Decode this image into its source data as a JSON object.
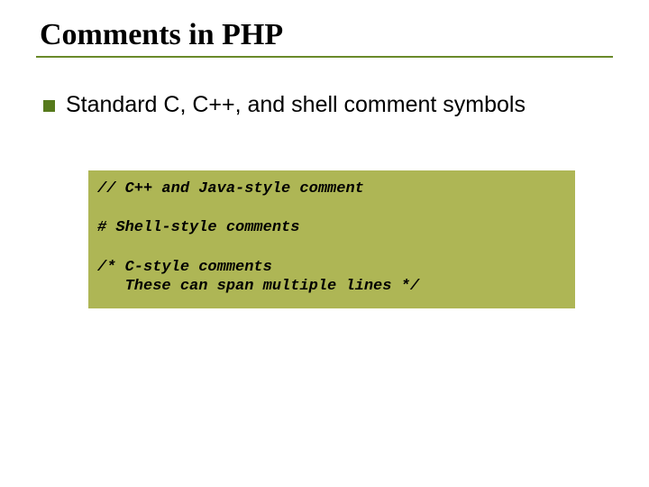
{
  "title": "Comments in PHP",
  "bullet": "Standard C, C++, and shell comment symbols",
  "code": {
    "line1": "// C++ and Java-style comment",
    "line2": "# Shell-style comments",
    "line3": "/* C-style comments",
    "line4": "   These can span multiple lines */"
  }
}
